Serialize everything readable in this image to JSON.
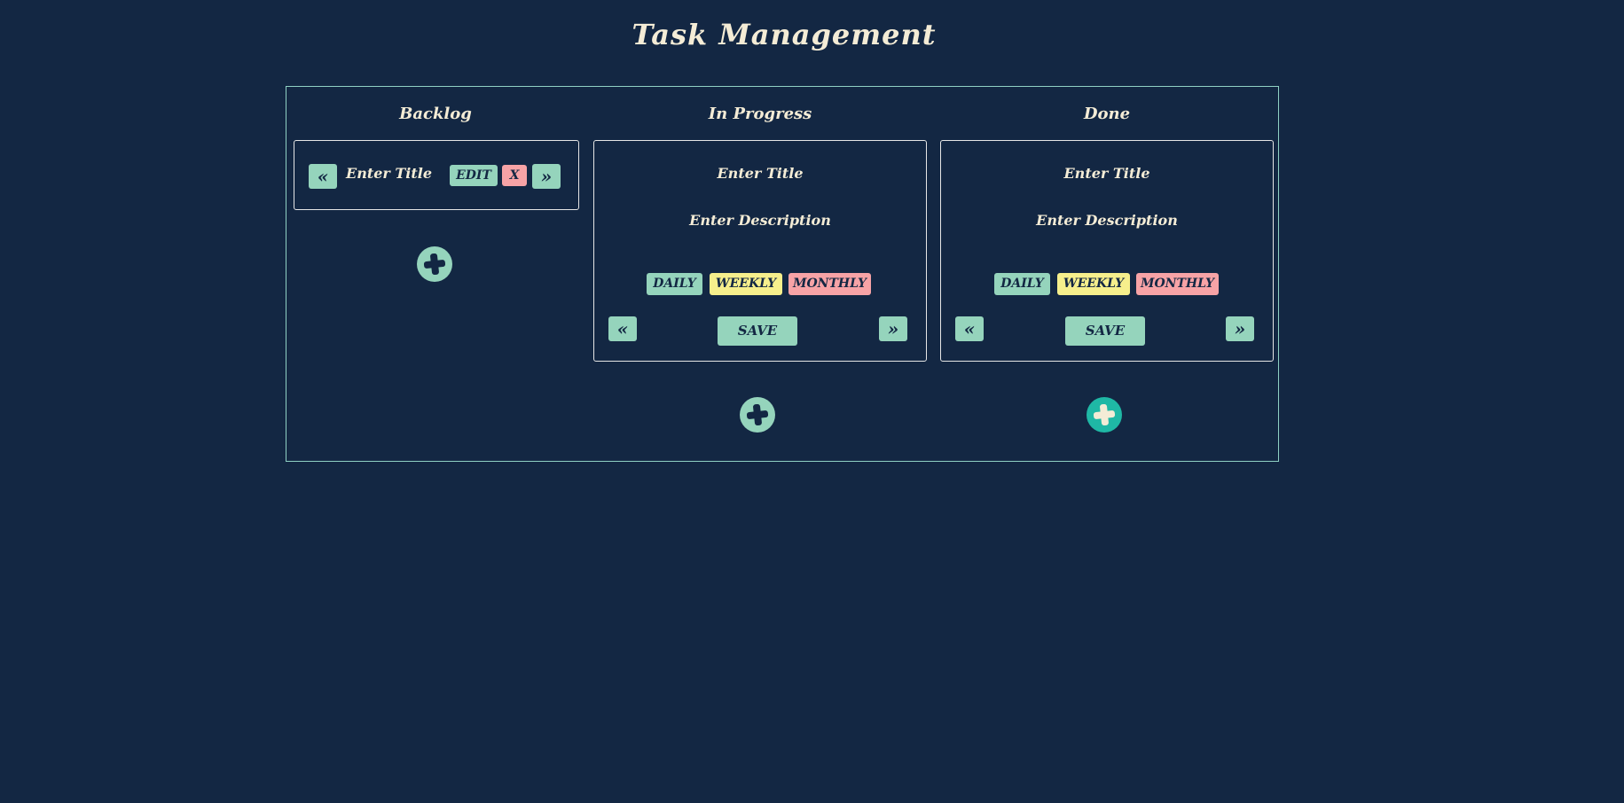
{
  "title": "Task Management",
  "columns": {
    "backlog": {
      "title": "Backlog",
      "card": {
        "prev_label": "«",
        "title": "Enter Title",
        "edit_label": "EDIT",
        "delete_label": "X",
        "next_label": "»"
      }
    },
    "in_progress": {
      "title": "In Progress",
      "card": {
        "title": "Enter Title",
        "description": "Enter Description",
        "tags": [
          "DAILY",
          "WEEKLY",
          "MONTHLY"
        ],
        "prev_label": "«",
        "save_label": "SAVE",
        "next_label": "»"
      }
    },
    "done": {
      "title": "Done",
      "card": {
        "title": "Enter Title",
        "description": "Enter Description",
        "tags": [
          "DAILY",
          "WEEKLY",
          "MONTHLY"
        ],
        "prev_label": "«",
        "save_label": "SAVE",
        "next_label": "»"
      }
    }
  },
  "colors": {
    "background": "#132743",
    "accent": "#95d4bc",
    "accent_active": "#1fb8a5",
    "daily": "#95d4bc",
    "weekly": "#f6ef8c",
    "monthly": "#f7a3a6",
    "text": "#f4ecd6"
  },
  "icons": {
    "add": "plus-icon"
  }
}
